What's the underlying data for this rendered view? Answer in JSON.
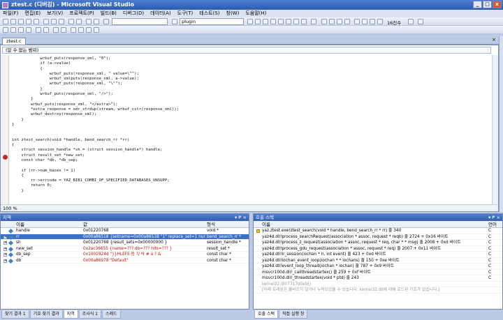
{
  "window": {
    "title": "ztest.c (디버깅) - Microsoft Visual Studio",
    "min": "_",
    "max": "□",
    "close": "x"
  },
  "menu": [
    "파일(F)",
    "편집(E)",
    "보기(V)",
    "프로젝트(P)",
    "빌드(B)",
    "디버그(D)",
    "데이터(A)",
    "도구(T)",
    "테스트(S)",
    "창(W)",
    "도움말(H)"
  ],
  "toolbar": {
    "solution_combo": "",
    "find_combo": "plugin",
    "hex_label": "16진수"
  },
  "editor": {
    "tab_label": "ztest.c",
    "tab_close": "×",
    "scope": "(알 수 없는 범위)",
    "zoom": "100 %",
    "lines": [
      "            wrbuf_puts(response_xml, \"0\");",
      "            if (a->value)",
      "            {",
      "                wrbuf_puts(response_xml, \" value=\\\"\");",
      "                wrbuf_xmlputs(response_xml, a->value);",
      "                wrbuf_puts(response_xml, \"\\\"\");",
      "            }",
      "            wrbuf_puts(response_xml, \"/>\");",
      "        }",
      "        wrbuf_puts(response_xml, \"</extra>\");",
      "        *extra_response = odr_strdup(stream, wrbuf_cstr(response_xml));",
      "        wrbuf_destroy(response_xml);",
      "    }",
      "}",
      "",
      "",
      "int ztest_search(void *handle, bend_search_rr *rr)",
      "{",
      "    struct session_handle *sh = (struct session_handle*) handle;",
      "    struct result_set *new_set;",
      "    const char *db, *db_sep;",
      "",
      "    if (rr->num_bases != 1)",
      "    {",
      "        rr->errcode = YAZ_BIB1_COMBI_OF_SPECIFIED_DATABASES_UNSUPP;",
      "        return 0;",
      "    }"
    ]
  },
  "locals": {
    "title": "지역",
    "pin": "▾ ₱ ×",
    "columns": [
      "이름",
      "값",
      "형식"
    ],
    "rows": [
      {
        "name": "handle",
        "value": "0x01220768",
        "type": "void *",
        "expand": "",
        "selected": false
      },
      {
        "name": "rr",
        "value": "0x00a86518 {setname=0x00a8653B \"1\" replace_set=1 num_base",
        "type": "bend_search_rr *",
        "expand": "+",
        "selected": true
      },
      {
        "name": "sh",
        "value": "0x01220768 {result_sets=0x00000000 }",
        "type": "session_handle *",
        "expand": "+",
        "selected": false
      },
      {
        "name": "new_set",
        "value": "0x2ac36655 {name=??? db=??? hits=???  }",
        "type": "result_set *",
        "expand": "+",
        "selected": false
      },
      {
        "name": "db_sep",
        "value": "0x1001924d \"}}HLEFE  듬       ?/  악   #     u   ?  &",
        "type": "const char *",
        "expand": "+",
        "selected": false
      },
      {
        "name": "db",
        "value": "0x00a86978 \"Default\"",
        "type": "const char *",
        "expand": "+",
        "selected": false
      }
    ]
  },
  "callstack": {
    "title": "호출 스택",
    "pin": "▾ ₱ ×",
    "columns": [
      "이름",
      "언어"
    ],
    "rows": [
      {
        "name": "yaz.ztest.exe!ztest_search(void * handle, bend_search_rr * rr)  줄 340",
        "lang": "C",
        "current": true,
        "grey": false
      },
      {
        "name": "yaz4d.dll!process_searchRequest(association * assoc, request * reqb)  줄 2724 + 0x16 바이트",
        "lang": "C",
        "current": false,
        "grey": false
      },
      {
        "name": "yaz4d.dll!process_z_request(association * assoc, request * req, char * * msg)  줄 2008 + 0xd 바이트",
        "lang": "C",
        "current": false,
        "grey": false
      },
      {
        "name": "yaz4d.dll!process_gdu_request(association * assoc, request * req)  줄 2007 + 0x11 바이트",
        "lang": "C",
        "current": false,
        "grey": false
      },
      {
        "name": "yaz4d.dll!ir_session(iochan * h, int event)  줄 423 + 0xd 바이트",
        "lang": "C",
        "current": false,
        "grey": false
      },
      {
        "name": "yaz4d.dll!iochan_event_loop(iochan * * iochans)  줄 150 + 0xe 바이트",
        "lang": "C",
        "current": false,
        "grey": false
      },
      {
        "name": "yaz4d.dll!event_loop_thread(iochan * iochan)  줄 787 + 0x9 바이트",
        "lang": "C",
        "current": false,
        "grey": false
      },
      {
        "name": "msvcr100d.dll!_callthreadstartex()  줄 259 + 0xf 바이트",
        "lang": "C",
        "current": false,
        "grey": false
      },
      {
        "name": "msvcr100d.dll!_threadstartex(void * ptd)  줄 243",
        "lang": "C",
        "current": false,
        "grey": false
      },
      {
        "name": "kernel32.dll!7717d0e9()",
        "lang": "",
        "current": false,
        "grey": true
      },
      {
        "name": "[아래 프레임은 올바르지 않거나 누락되었을 수 있습니다. kernel32.dll에 대해 로드된 기호가 없습니다.]",
        "lang": "",
        "current": false,
        "grey": true
      }
    ]
  },
  "bottom_tabs_left": [
    "찾기 결과 1",
    "기호 찾기 결과",
    "지역",
    "조사식 1",
    "스레드"
  ],
  "bottom_tabs_right": [
    "호출 스택",
    "직접 실행 창"
  ]
}
